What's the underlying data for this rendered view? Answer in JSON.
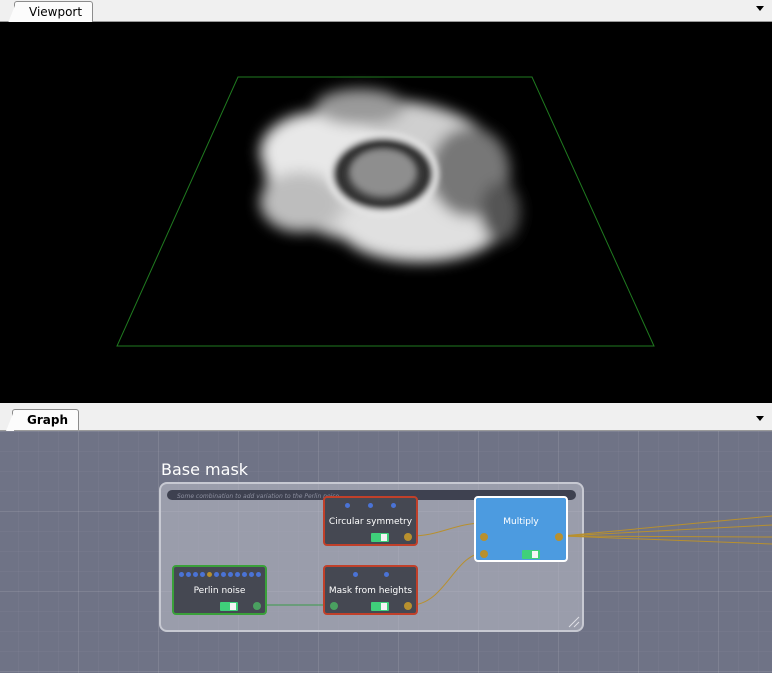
{
  "viewport_panel": {
    "tab_label": "Viewport"
  },
  "graph_panel": {
    "tab_label": "Graph",
    "frame": {
      "title": "Base mask",
      "comment": "Some combination to add variation to the Perlin noise"
    },
    "nodes": {
      "circular_symmetry": {
        "label": "Circular symmetry"
      },
      "mask_from_heights": {
        "label": "Mask from heights"
      },
      "perlin_noise": {
        "label": "Perlin noise"
      },
      "multiply": {
        "label": "Multiply"
      }
    }
  },
  "colors": {
    "viewport_bg": "#000000",
    "terrain_outline": "#1f7a1f",
    "graph_bg": "#6f7386",
    "node_border_red": "#c0402a",
    "node_border_green": "#3aa03a",
    "multiply_fill": "#4c9be0",
    "port_gold": "#b8902e",
    "port_green": "#4aa060",
    "link_gold": "#b8902e",
    "link_green": "#3a9a4a",
    "toggle_green": "#3fd07a"
  }
}
